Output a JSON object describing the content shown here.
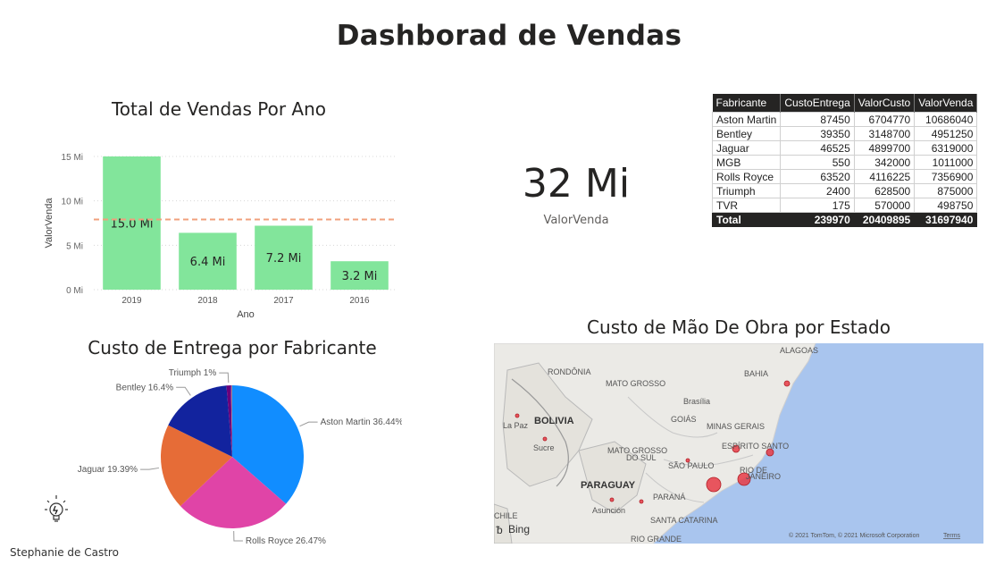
{
  "page": {
    "title": "Dashborad de Vendas",
    "author": "Stephanie de Castro"
  },
  "bar_visual": {
    "title": "Total de Vendas Por Ano"
  },
  "pie_visual": {
    "title": "Custo de Entrega por Fabricante"
  },
  "map_visual": {
    "title": "Custo de Mão De Obra por Estado",
    "labels": [
      "ALAGOAS",
      "RONDÔNIA",
      "BAHIA",
      "MATO GROSSO",
      "Brasília",
      "BOLIVIA",
      "GOIÁS",
      "La Paz",
      "MINAS GERAIS",
      "Sucre",
      "MATO GROSSO",
      "DO SUL",
      "ESPÍRITO SANTO",
      "SÃO PAULO",
      "RIO DE",
      "JANEIRO",
      "PARAGUAY",
      "PARANÁ",
      "Asunción",
      "CHILE",
      "SANTA CATARINA",
      "RIO GRANDE"
    ],
    "bing": "Bing",
    "copyright": "© 2021 TomTom, © 2021 Microsoft Corporation",
    "terms": "Terms"
  },
  "kpi": {
    "value": "32 Mi",
    "label": "ValorVenda"
  },
  "table": {
    "headers": [
      "Fabricante",
      "CustoEntrega",
      "ValorCusto",
      "ValorVenda"
    ],
    "rows": [
      [
        "Aston Martin",
        "87450",
        "6704770",
        "10686040"
      ],
      [
        "Bentley",
        "39350",
        "3148700",
        "4951250"
      ],
      [
        "Jaguar",
        "46525",
        "4899700",
        "6319000"
      ],
      [
        "MGB",
        "550",
        "342000",
        "1011000"
      ],
      [
        "Rolls Royce",
        "63520",
        "4116225",
        "7356900"
      ],
      [
        "Triumph",
        "2400",
        "628500",
        "875000"
      ],
      [
        "TVR",
        "175",
        "570000",
        "498750"
      ]
    ],
    "total": [
      "Total",
      "239970",
      "20409895",
      "31697940"
    ]
  },
  "chart_data": [
    {
      "type": "bar",
      "title": "Total de Vendas Por Ano",
      "xlabel": "Ano",
      "ylabel": "ValorVenda",
      "categories": [
        "2019",
        "2018",
        "2017",
        "2016"
      ],
      "values": [
        15.0,
        6.4,
        7.2,
        3.2
      ],
      "data_labels": [
        "15.0 Mi",
        "6.4 Mi",
        "7.2 Mi",
        "3.2 Mi"
      ],
      "yticks": [
        "0 Mi",
        "5 Mi",
        "10 Mi",
        "15 Mi"
      ],
      "ylim": [
        0,
        15
      ],
      "average_line": 7.9,
      "grid": true,
      "color": "#82e59b",
      "average_color": "#f0a07c"
    },
    {
      "type": "pie",
      "title": "Custo de Entrega por Fabricante",
      "slices": [
        {
          "label": "Aston Martin 36.44%",
          "value": 36.44,
          "color": "#118dff"
        },
        {
          "label": "Rolls Royce 26.47%",
          "value": 26.47,
          "color": "#e044a7"
        },
        {
          "label": "Jaguar 19.39%",
          "value": 19.39,
          "color": "#e66c37"
        },
        {
          "label": "Bentley 16.4%",
          "value": 16.4,
          "color": "#12239e"
        },
        {
          "label": "Triumph 1%",
          "value": 1.0,
          "color": "#6b007b"
        },
        {
          "label": "",
          "value": 0.23,
          "color": "#744ec2"
        },
        {
          "label": "",
          "value": 0.07,
          "color": "#d9b300"
        }
      ]
    }
  ]
}
